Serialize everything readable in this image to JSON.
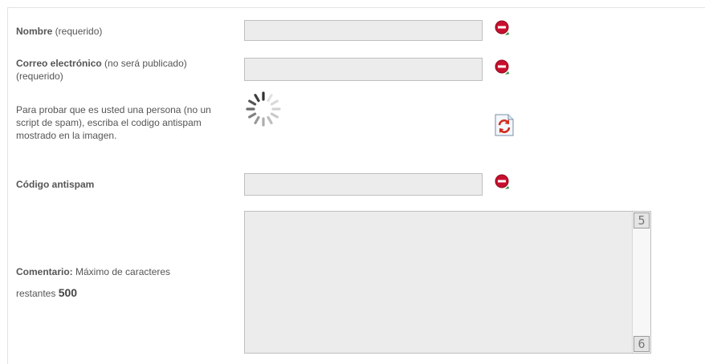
{
  "form": {
    "name": {
      "label": "Nombre",
      "note": " (requerido)",
      "value": ""
    },
    "email": {
      "label": "Correo electrónico",
      "note": " (no será publicado)",
      "note2": "(requerido)",
      "value": ""
    },
    "captcha_instructions": [
      "Para probar que es usted una persona (no un",
      "script de spam), escriba el codigo antispam",
      "mostrado en la imagen."
    ],
    "antispam": {
      "label": "Código antispam",
      "value": ""
    },
    "comment": {
      "label": "Comentario:",
      "note": " Máximo de caracteres",
      "note2": "restantes ",
      "remaining": "500",
      "value": "",
      "scroll_up": "5",
      "scroll_down": "6"
    }
  },
  "icons": {
    "required": "no-entry-required-icon",
    "loading": "loading-spinner-icon",
    "refresh": "refresh-captcha-icon"
  },
  "colors": {
    "required_red": "#c8102e",
    "required_green_dot": "#2e8b3a",
    "field_bg": "#ececec",
    "field_border": "#bfbfbf"
  }
}
